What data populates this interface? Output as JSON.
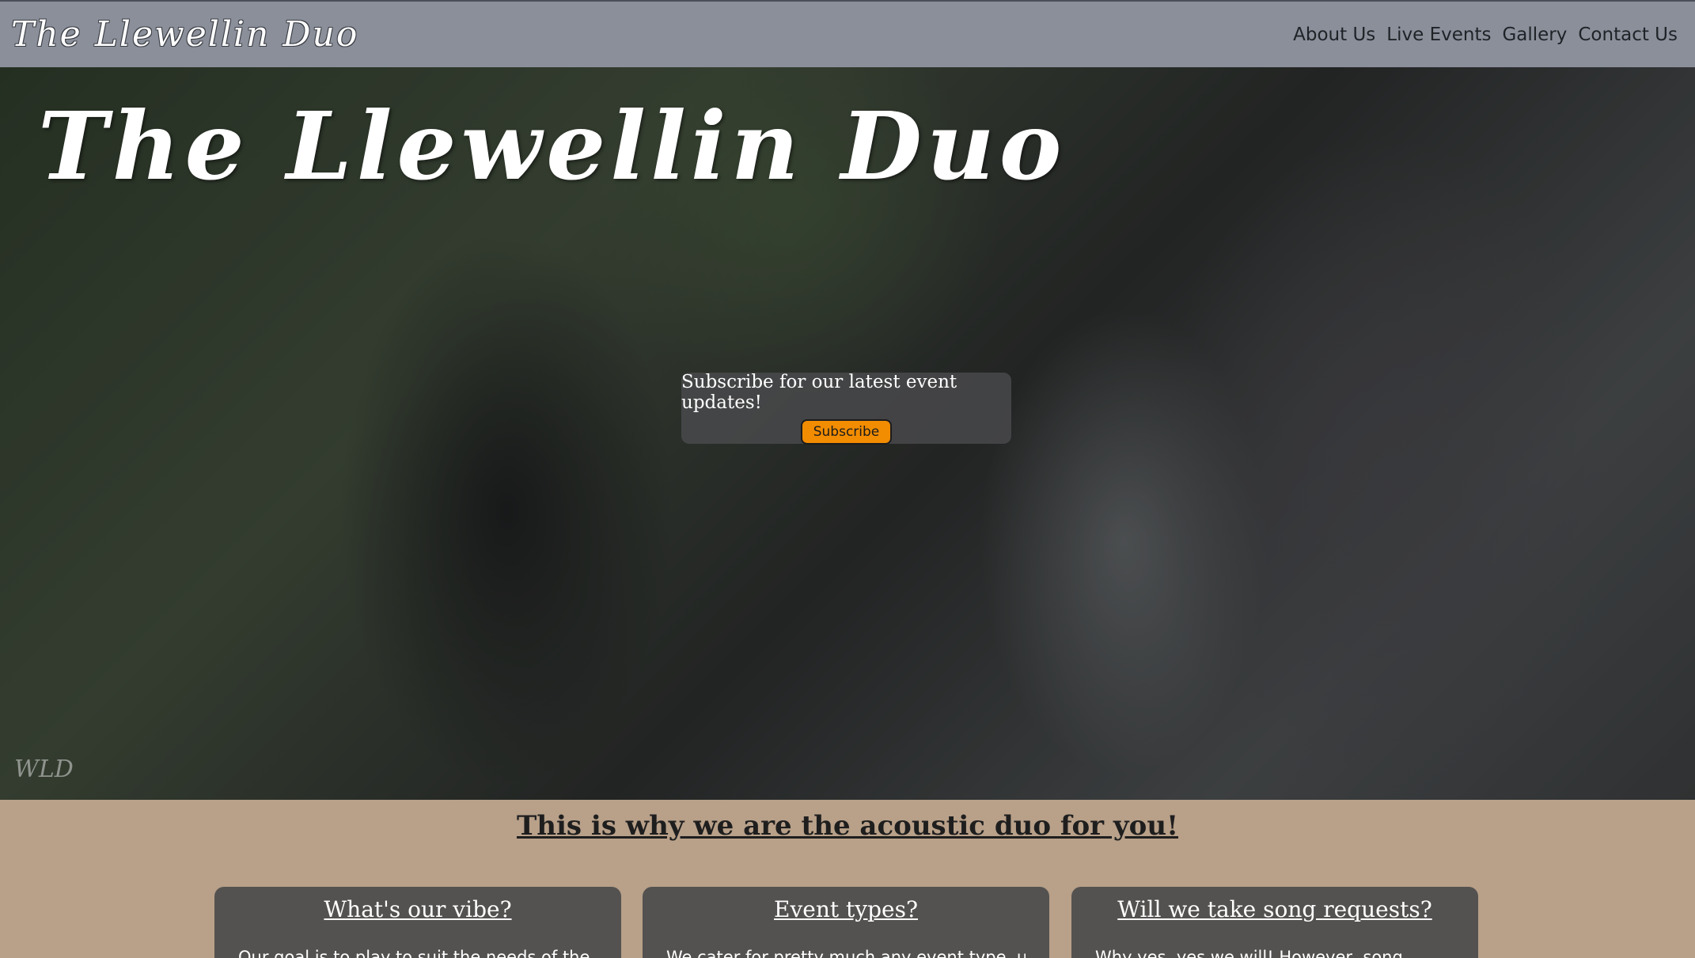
{
  "nav": {
    "logo": "The Llewellin Duo",
    "links": [
      "About Us",
      "Live Events",
      "Gallery",
      "Contact Us"
    ]
  },
  "hero": {
    "title": "The Llewellin Duo",
    "watermark": "WLD",
    "subscribe": {
      "text": "Subscribe for our latest event updates!",
      "button_label": "Subscribe"
    }
  },
  "section": {
    "heading": "This is why we are the acoustic duo for you!",
    "cards": [
      {
        "title": "What's our vibe?",
        "text": "Our goal is to play to suit the needs of the"
      },
      {
        "title": "Event types?",
        "text": "We cater for pretty much any event type, up"
      },
      {
        "title": "Will we take song requests?",
        "text": "Why yes, yes we will! However, song"
      }
    ]
  },
  "colors": {
    "navbar": "#8a8f9a",
    "accent_button": "#f28c00",
    "page_background": "#b8a089",
    "card_background": "#545250"
  }
}
